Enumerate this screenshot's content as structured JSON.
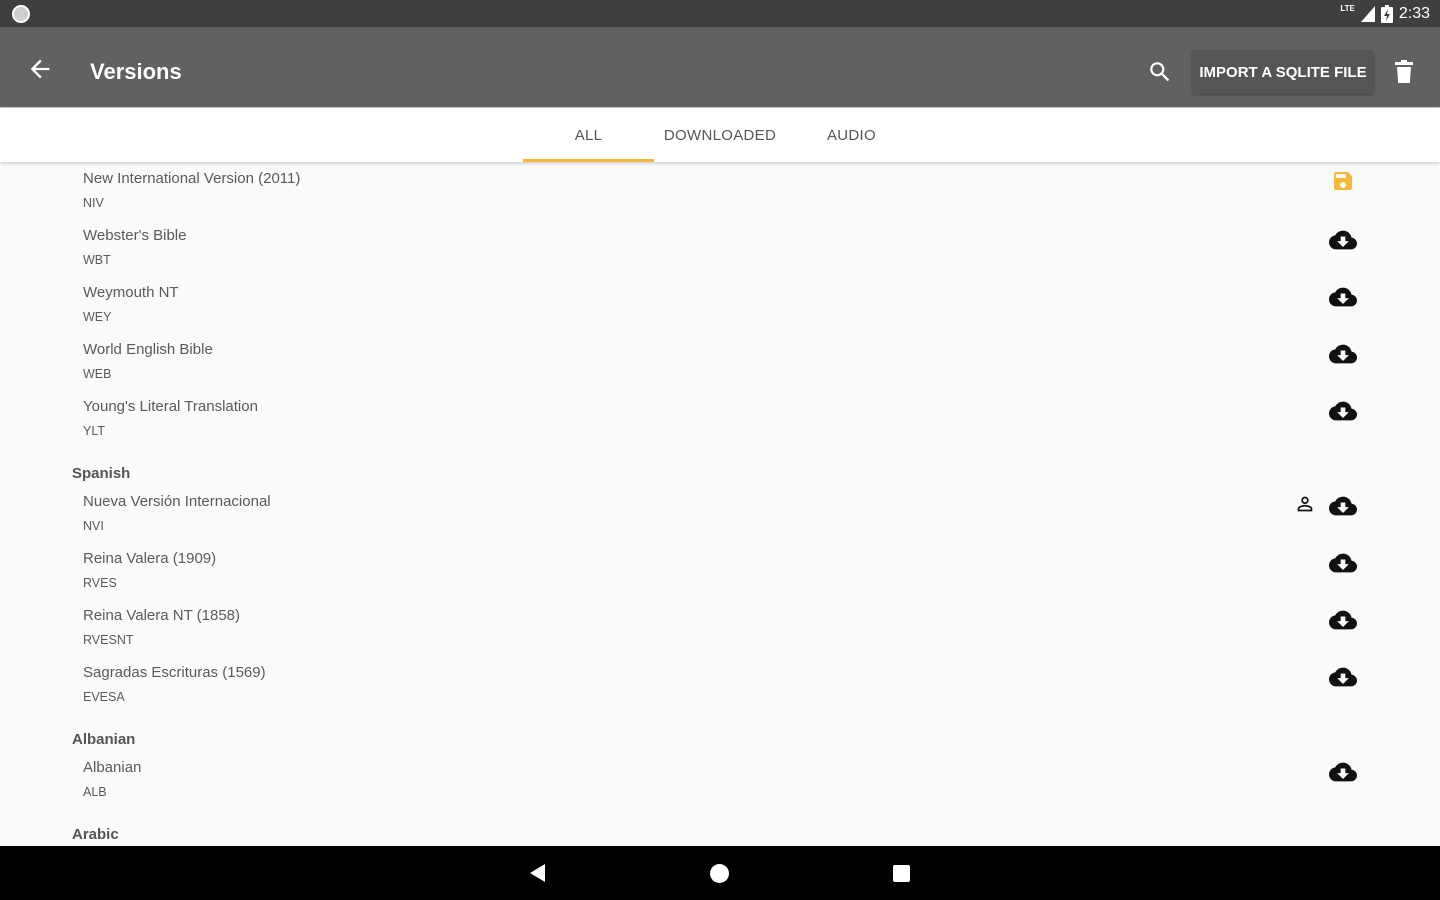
{
  "status_bar": {
    "time": "2:33",
    "network": "LTE"
  },
  "app_bar": {
    "title": "Versions",
    "import_label": "IMPORT A SQLITE FILE"
  },
  "tabs": [
    {
      "label": "ALL",
      "active": true
    },
    {
      "label": "DOWNLOADED",
      "active": false
    },
    {
      "label": "AUDIO",
      "active": false
    }
  ],
  "list": {
    "english_items": [
      {
        "name": "New International Version (2011)",
        "abbr": "NIV",
        "icon": "save-icon"
      },
      {
        "name": "Webster's Bible",
        "abbr": "WBT",
        "icon": "cloud-download-icon"
      },
      {
        "name": "Weymouth NT",
        "abbr": "WEY",
        "icon": "cloud-download-icon"
      },
      {
        "name": "World English Bible",
        "abbr": "WEB",
        "icon": "cloud-download-icon"
      },
      {
        "name": "Young's Literal Translation",
        "abbr": "YLT",
        "icon": "cloud-download-icon"
      }
    ],
    "groups": {
      "spanish": "Spanish",
      "albanian": "Albanian",
      "arabic": "Arabic"
    },
    "spanish_items": [
      {
        "name": "Nueva Versión Internacional",
        "abbr": "NVI",
        "icon": "cloud-download-icon"
      },
      {
        "name": "Reina Valera (1909)",
        "abbr": "RVES",
        "icon": "cloud-download-icon"
      },
      {
        "name": "Reina Valera NT (1858)",
        "abbr": "RVESNT",
        "icon": "cloud-download-icon"
      },
      {
        "name": "Sagradas Escrituras (1569)",
        "abbr": "EVESA",
        "icon": "cloud-download-icon"
      }
    ],
    "albanian_items": [
      {
        "name": "Albanian",
        "abbr": "ALB",
        "icon": "cloud-download-icon"
      }
    ]
  },
  "colors": {
    "app_bar": "#616161",
    "accent": "#f5b83a",
    "saved_icon": "#f5b83a"
  }
}
